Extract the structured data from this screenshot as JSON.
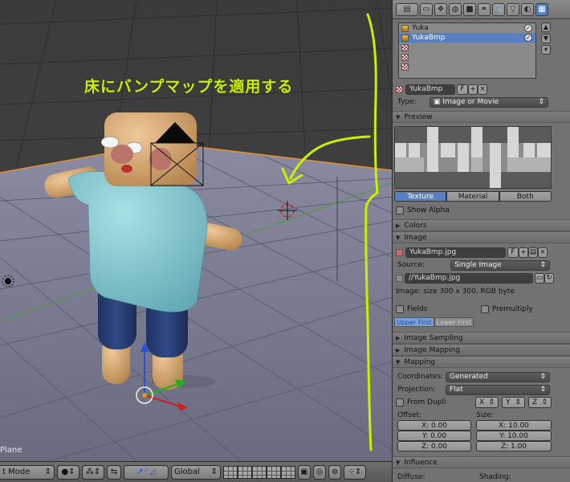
{
  "viewport": {
    "object_label": "Plane",
    "annotation": "床にバンプマップを適用する"
  },
  "viewport_header": {
    "mode_label": "t Mode",
    "orientation_label": "Global"
  },
  "properties": {
    "slots": [
      {
        "name": "Yuka",
        "selected": false
      },
      {
        "name": "YukaBmp",
        "selected": true
      },
      {
        "name": "",
        "selected": false
      },
      {
        "name": "",
        "selected": false
      },
      {
        "name": "",
        "selected": false
      }
    ],
    "texture_name": "YukaBmp",
    "texture_users": "F",
    "type_label": "Type:",
    "type_value": "Image or Movie",
    "preview_title": "Preview",
    "preview_tabs": [
      "Texture",
      "Material",
      "Both"
    ],
    "show_alpha": "Show Alpha",
    "colors_title": "Colors",
    "image_title": "Image",
    "image_name": "YukaBmp.jpg",
    "image_users": "F",
    "source_label": "Source:",
    "source_value": "Single Image",
    "filepath": "//YukaBmp.jpg",
    "image_info": "Image: size 300 x 300, RGB byte",
    "fields_label": "Fields",
    "premultiply_label": "Premultiply",
    "field_order": [
      "Upper First",
      "Lower First"
    ],
    "image_sampling_title": "Image Sampling",
    "image_mapping_title": "Image Mapping",
    "mapping_title": "Mapping",
    "coordinates_label": "Coordinates:",
    "coordinates_value": "Generated",
    "projection_label": "Projection:",
    "projection_value": "Flat",
    "from_dupli": "From Dupli",
    "axes": [
      "X",
      "Y",
      "Z"
    ],
    "offset_label": "Offset:",
    "size_label": "Size:",
    "offset": [
      "X: 0.00",
      "Y: 0.00",
      "Z: 0.00"
    ],
    "size": [
      "X: 10.00",
      "Y: 10.00",
      "Z: 1.00"
    ],
    "influence_title": "Influence",
    "diffuse_label": "Diffuse:",
    "shading_label": "Shading:"
  }
}
